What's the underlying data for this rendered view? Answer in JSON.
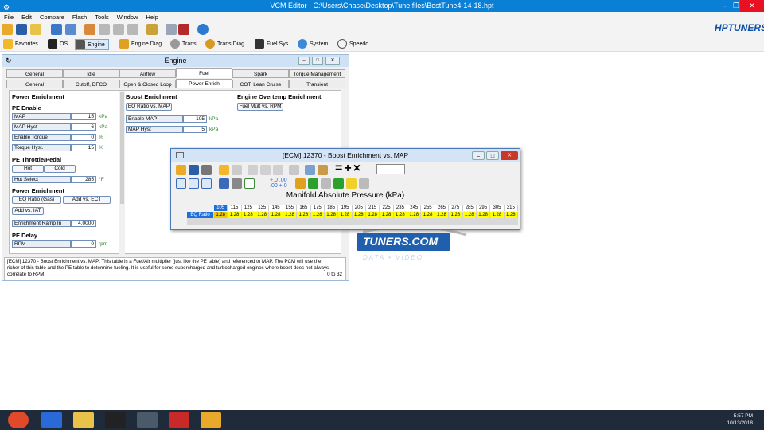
{
  "app": {
    "title": "VCM Editor - C:\\Users\\Chase\\Desktop\\Tune files\\BestTune4-14-18.hpt",
    "menu": [
      "File",
      "Edit",
      "Compare",
      "Flash",
      "Tools",
      "Window",
      "Help"
    ],
    "logo": "HPTUNERS",
    "nav": [
      "Favorites",
      "OS",
      "Engine",
      "Engine Diag",
      "Trans",
      "Trans Diag",
      "Fuel Sys",
      "System",
      "Speedo"
    ]
  },
  "engine": {
    "title": "Engine",
    "tabs_row1": [
      "General",
      "Idle",
      "Airflow",
      "Fuel",
      "Spark",
      "Torque Management"
    ],
    "tabs_row2": [
      "General",
      "Cutoff, DFCO",
      "Open & Closed Loop",
      "Power Enrich",
      "COT, Lean Cruise",
      "Transient"
    ],
    "power_enrichment_header": "Power Enrichment",
    "pe_enable": "PE Enable",
    "map_label": "MAP",
    "map_value": "15",
    "map_unit": "kPa",
    "map_hyst_label": "MAP Hyst",
    "map_hyst_value": "6",
    "map_hyst_unit": "kPa",
    "enable_torque_label": "Enable Torque",
    "enable_torque_value": "0",
    "enable_torque_unit": "%",
    "torque_hyst_label": "Torque Hyst.",
    "torque_hyst_value": "15",
    "torque_hyst_unit": "%",
    "pe_throttle": "PE Throttle/Pedal",
    "hot": "Hot",
    "cold": "Cold",
    "hot_select_label": "Hot Select",
    "hot_select_value": "285",
    "hot_select_unit": "°F",
    "power_enrichment2": "Power Enrichment",
    "eq_gas": "EQ Ratio (Gas)",
    "add_ect": "Add vs. ECT",
    "add_iat": "Add vs. IAT",
    "ramp_label": "Enrichment Ramp In",
    "ramp_value": "4.0000",
    "pe_delay": "PE Delay",
    "rpm_label": "RPM",
    "rpm_value": "0",
    "rpm_unit": "rpm",
    "boost_header": "Boost Enrichment",
    "eq_map": "EQ Ratio vs. MAP",
    "enable_map_label": "Enable MAP",
    "enable_map_value": "105",
    "enable_map_unit": "kPa",
    "boost_map_hyst_label": "MAP Hyst",
    "boost_map_hyst_value": "5",
    "boost_map_hyst_unit": "kPa",
    "overtemp_header": "Engine Overtemp Enrichment",
    "fuel_mult": "Fuel Mult vs. RPM",
    "desc_line1": "[ECM] 12370 - Boost Enrichment vs. MAP: This table is a Fuel/Air multiplier (just like the PE table) and referenced to MAP. The PCM will use the",
    "desc_line2": "richer of this table and the PE table to determine fueling. It is useful for some supercharged and turbocharged engines where boost does not always",
    "desc_line3": "correlate to RPM.",
    "desc_range": "0 to 32"
  },
  "table": {
    "title": "[ECM] 12370 - Boost Enrichment vs. MAP",
    "axis_label": "Manifold Absolute Pressure (kPa)",
    "row_label": "EQ Ratio",
    "columns": [
      "105",
      "115",
      "125",
      "135",
      "145",
      "155",
      "165",
      "175",
      "185",
      "195",
      "205",
      "215",
      "225",
      "235",
      "245",
      "255",
      "265",
      "275",
      "285",
      "295",
      "305",
      "315"
    ],
    "values": [
      "1.28",
      "1.28",
      "1.28",
      "1.28",
      "1.28",
      "1.28",
      "1.28",
      "1.28",
      "1.28",
      "1.28",
      "1.28",
      "1.28",
      "1.28",
      "1.28",
      "1.28",
      "1.28",
      "1.28",
      "1.28",
      "1.28",
      "1.28",
      "1.28",
      "1.28"
    ]
  },
  "background_logo": {
    "text": "TUNERS.COM",
    "tagline": "DATA • VIDEO",
    "dial": "140 150"
  },
  "taskbar": {
    "time": "5:57 PM",
    "date": "10/13/2018"
  },
  "colors": {
    "titlebar": "#0a7fd6",
    "selected_cell": "#ffff00",
    "header_cell": "#1e6fd9"
  }
}
